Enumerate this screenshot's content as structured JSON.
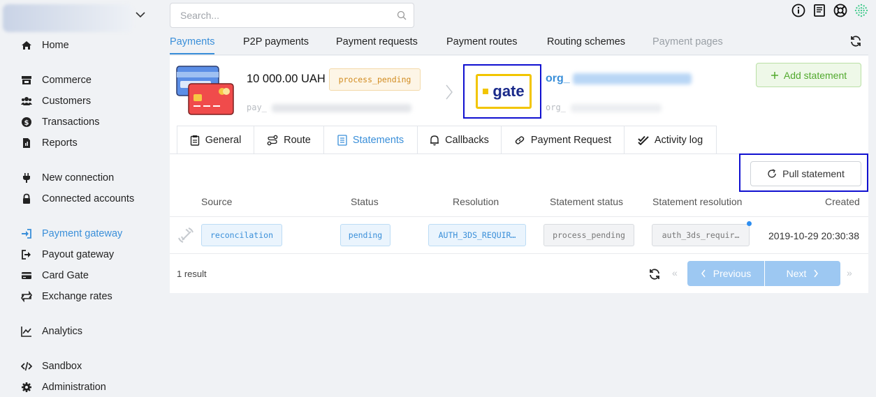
{
  "sidebar": {
    "items": [
      {
        "label": "Home",
        "icon": "home-icon"
      },
      {
        "label": "Commerce",
        "icon": "store-icon"
      },
      {
        "label": "Customers",
        "icon": "users-icon"
      },
      {
        "label": "Transactions",
        "icon": "dollar-icon"
      },
      {
        "label": "Reports",
        "icon": "report-icon"
      },
      {
        "label": "New connection",
        "icon": "plug-icon"
      },
      {
        "label": "Connected accounts",
        "icon": "lock-icon"
      },
      {
        "label": "Payment gateway",
        "icon": "sign-in-icon",
        "active": true
      },
      {
        "label": "Payout gateway",
        "icon": "sign-out-icon"
      },
      {
        "label": "Card Gate",
        "icon": "credit-card-icon"
      },
      {
        "label": "Exchange rates",
        "icon": "exchange-icon"
      },
      {
        "label": "Analytics",
        "icon": "chart-icon"
      },
      {
        "label": "Sandbox",
        "icon": "code-icon"
      },
      {
        "label": "Administration",
        "icon": "gear-icon"
      }
    ]
  },
  "search": {
    "placeholder": "Search..."
  },
  "tabs": [
    {
      "label": "Payments",
      "state": "active"
    },
    {
      "label": "P2P payments",
      "state": "normal"
    },
    {
      "label": "Payment requests",
      "state": "normal"
    },
    {
      "label": "Payment routes",
      "state": "normal"
    },
    {
      "label": "Routing schemes",
      "state": "normal"
    },
    {
      "label": "Payment pages",
      "state": "disabled"
    }
  ],
  "payment": {
    "amount": "10 000.00 UAH",
    "status": "process_pending",
    "id_prefix": "pay_",
    "gateway_logo_text": "gate",
    "org_prefix": "org_",
    "org_id_prefix": "org_",
    "add_statement_label": "Add statement"
  },
  "subtabs": [
    {
      "label": "General",
      "icon": "clipboard-icon"
    },
    {
      "label": "Route",
      "icon": "route-icon"
    },
    {
      "label": "Statements",
      "icon": "list-icon",
      "active": true
    },
    {
      "label": "Callbacks",
      "icon": "bell-icon"
    },
    {
      "label": "Payment Request",
      "icon": "link-icon"
    },
    {
      "label": "Activity log",
      "icon": "check-double-icon"
    }
  ],
  "pull_statement_label": "Pull statement",
  "table": {
    "headers": [
      "Source",
      "Status",
      "Resolution",
      "Statement status",
      "Statement resolution",
      "Created"
    ],
    "rows": [
      {
        "source": "reconcilation",
        "status": "pending",
        "resolution": "AUTH_3DS_REQUIR…",
        "statement_status": "process_pending",
        "statement_resolution": "auth_3ds_requir…",
        "created": "2019-10-29 20:30:38"
      }
    ]
  },
  "footer": {
    "result_count": "1 result",
    "previous_label": "Previous",
    "next_label": "Next"
  },
  "colors": {
    "accent": "#3a8fd9",
    "highlight_border": "#1010d0",
    "success": "#52a92e",
    "warning": "#d18b1f"
  }
}
